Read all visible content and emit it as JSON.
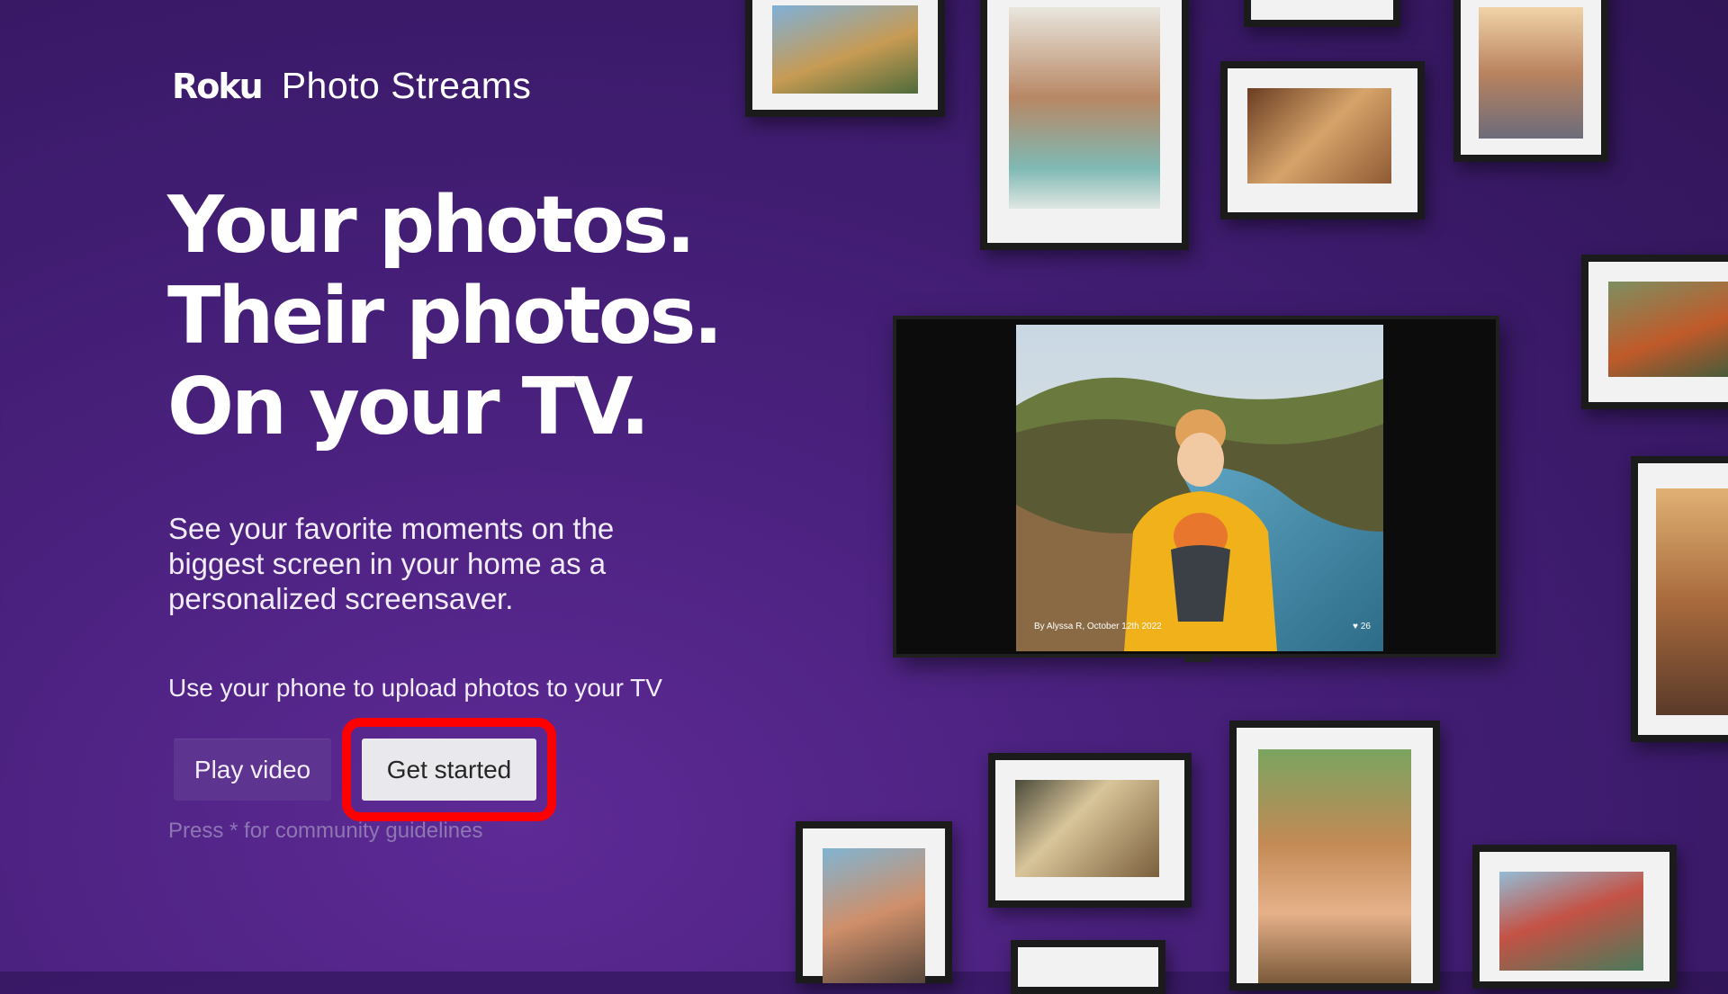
{
  "brand": {
    "logo": "Roku",
    "product": "Photo Streams"
  },
  "headline": [
    "Your photos.",
    "Their photos.",
    "On your TV."
  ],
  "description": "See your favorite moments on the biggest screen in your home as a personalized screensaver.",
  "upload_hint": "Use your phone to upload photos to your TV",
  "buttons": {
    "play_video": "Play video",
    "get_started": "Get started"
  },
  "guidelines": "Press * for community guidelines",
  "tv": {
    "caption": "By Alyssa R, October 12th 2022",
    "likes": "26"
  },
  "colors": {
    "background": "#4a217e",
    "focus_ring": "#ff0000",
    "button_active": "#e9e8ec",
    "button_inactive": "#5d348f"
  },
  "icons": {
    "likes": "heart-icon"
  }
}
